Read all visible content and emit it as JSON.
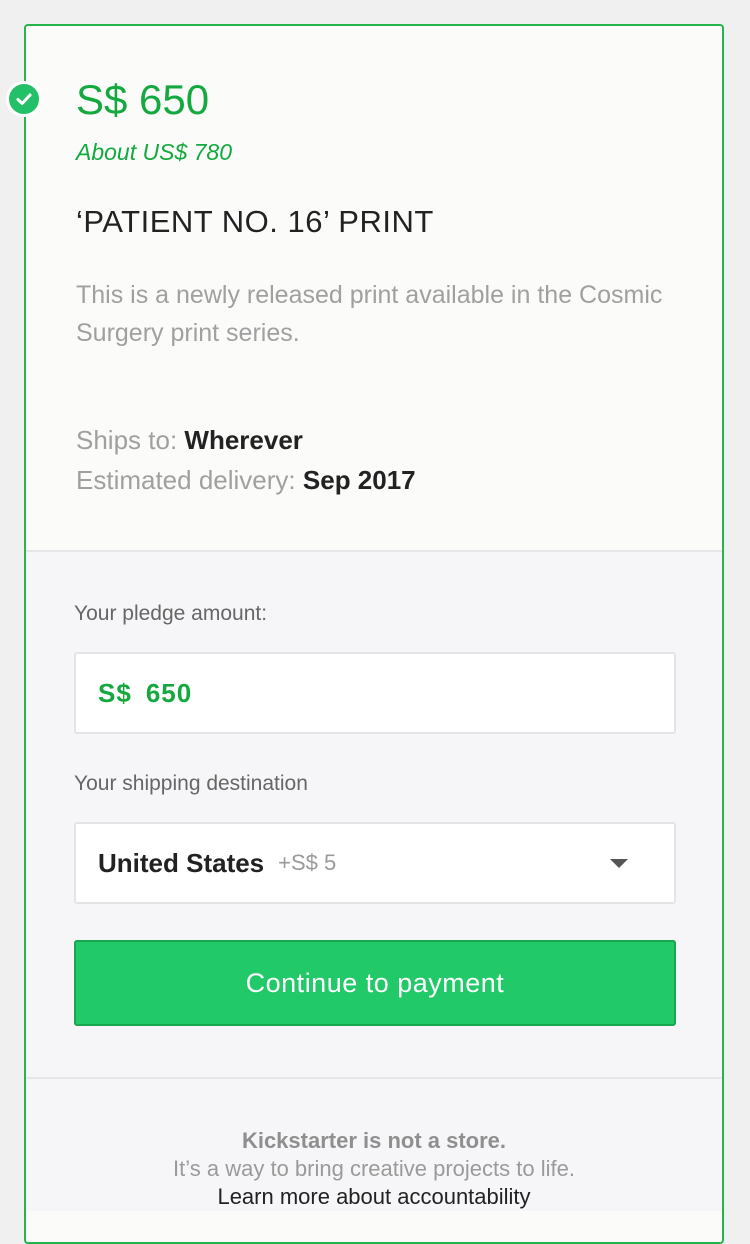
{
  "reward": {
    "price": "S$ 650",
    "price_usd": "About US$ 780",
    "title": "‘PATIENT NO. 16’ PRINT",
    "description": "This is a newly released print available in the Cosmic Surgery print series.",
    "ships_to_label": "Ships to:",
    "ships_to_value": "Wherever",
    "delivery_label": "Estimated delivery:",
    "delivery_value": "Sep 2017"
  },
  "pledge": {
    "amount_label": "Your pledge amount:",
    "currency": "S$",
    "amount_value": "650",
    "shipping_label": "Your shipping destination",
    "shipping_country": "United States",
    "shipping_extra": "+S$ 5",
    "continue_label": "Continue to payment"
  },
  "footer": {
    "line1": "Kickstarter is not a store.",
    "line2": "It’s a way to bring creative projects to life.",
    "link": "Learn more about accountability"
  },
  "colors": {
    "accent_green": "#14a93f",
    "button_green": "#22c968",
    "border_green": "#25b54a"
  }
}
